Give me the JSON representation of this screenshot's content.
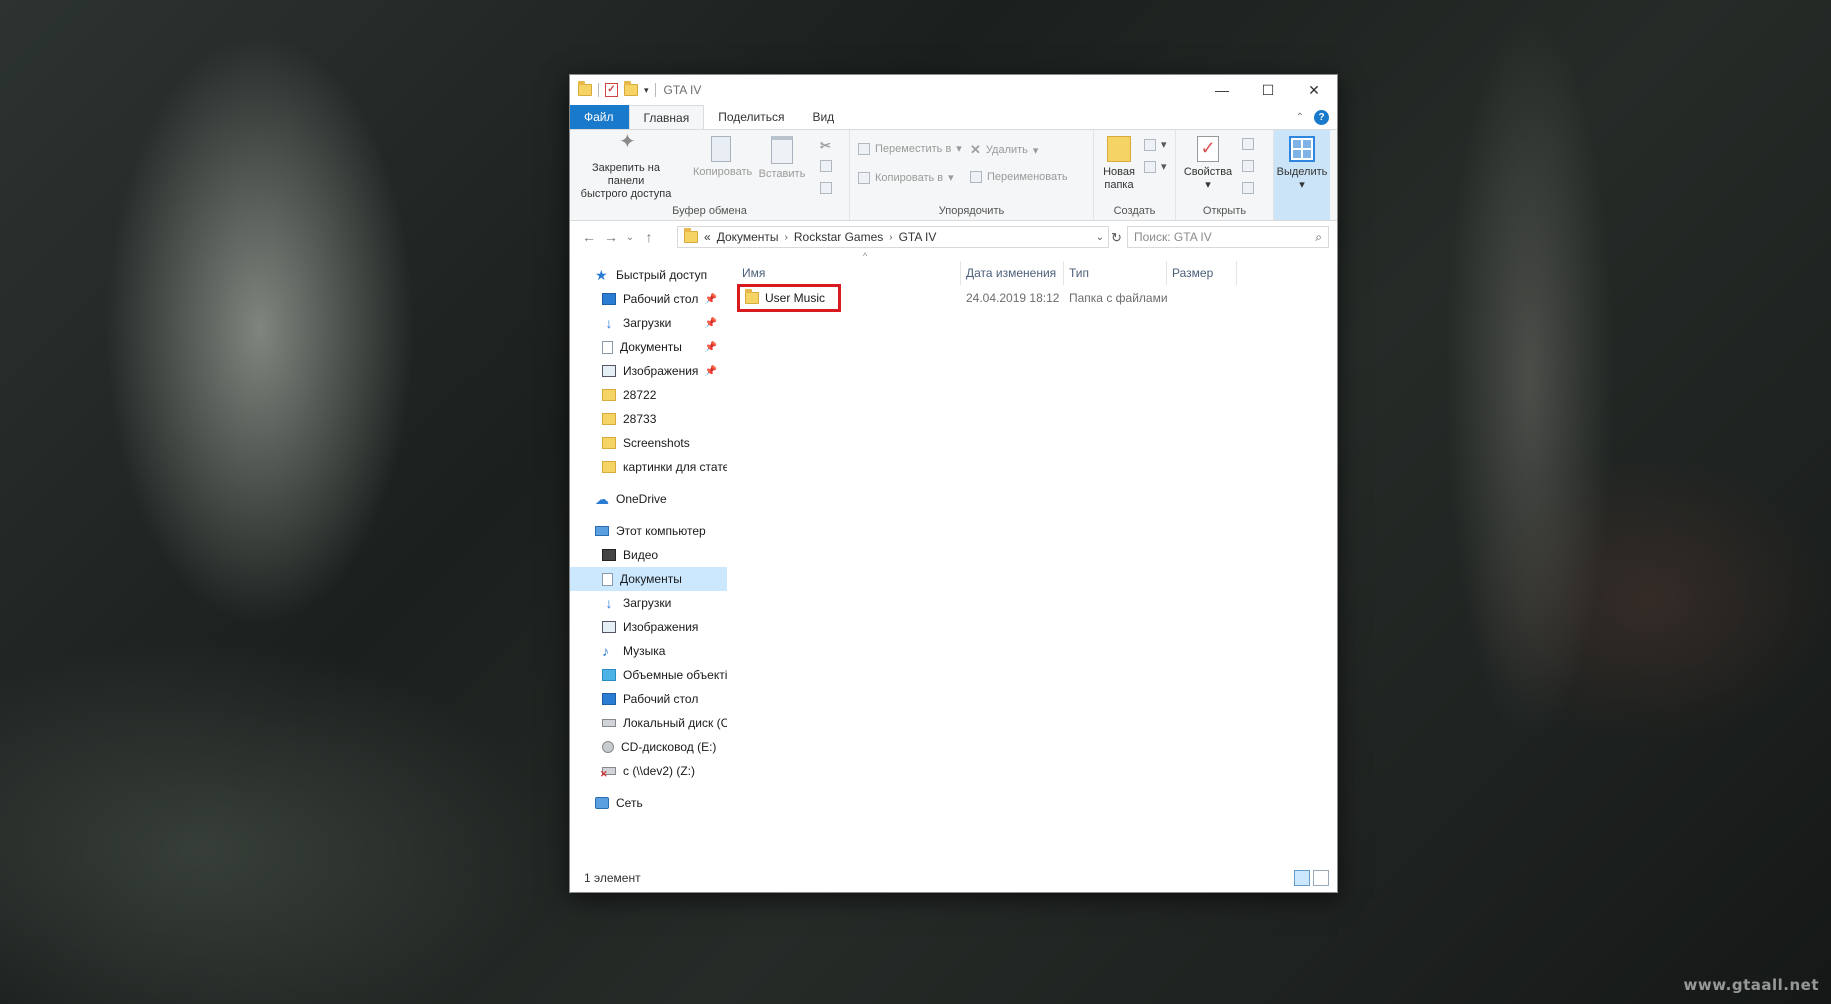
{
  "window": {
    "title": "GTA IV",
    "controls": {
      "minimize": "—",
      "maximize": "☐",
      "close": "✕"
    }
  },
  "tabs": [
    {
      "label": "Файл"
    },
    {
      "label": "Главная"
    },
    {
      "label": "Поделиться"
    },
    {
      "label": "Вид"
    }
  ],
  "ribbon": {
    "pin_label_1": "Закрепить на панели",
    "pin_label_2": "быстрого доступа",
    "copy": "Копировать",
    "paste": "Вставить",
    "clipboard_group": "Буфер обмена",
    "move_to": "Переместить в",
    "copy_to": "Копировать в",
    "delete": "Удалить",
    "rename": "Переименовать",
    "organize_group": "Упорядочить",
    "new_folder_1": "Новая",
    "new_folder_2": "папка",
    "create_group": "Создать",
    "properties": "Свойства",
    "open_group": "Открыть",
    "select": "Выделить"
  },
  "address": {
    "overflow": "«",
    "crumbs": [
      "Документы",
      "Rockstar Games",
      "GTA IV"
    ]
  },
  "search": {
    "placeholder": "Поиск: GTA IV"
  },
  "nav": {
    "quick_access": "Быстрый доступ",
    "quick_items": [
      "Рабочий стол",
      "Загрузки",
      "Документы",
      "Изображения",
      "28722",
      "28733",
      "Screenshots",
      "картинки для стате"
    ],
    "onedrive": "OneDrive",
    "this_pc": "Этот компьютер",
    "pc_items": [
      "Видео",
      "Документы",
      "Загрузки",
      "Изображения",
      "Музыка",
      "Объемные объекті",
      "Рабочий стол",
      "Локальный диск (C",
      "CD-дисковод (E:)",
      "c (\\\\dev2) (Z:)"
    ],
    "network": "Сеть"
  },
  "columns": [
    "Имя",
    "Дата изменения",
    "Тип",
    "Размер"
  ],
  "files": [
    {
      "name": "User Music",
      "modified": "24.04.2019 18:12",
      "type": "Папка с файлами",
      "size": ""
    }
  ],
  "status": {
    "count": "1 элемент"
  },
  "wallpaper": {
    "watermark": "www.gtaall.net"
  },
  "colors": {
    "accent": "#1979ca",
    "highlight": "#d71920",
    "selection": "#cce8ff"
  }
}
